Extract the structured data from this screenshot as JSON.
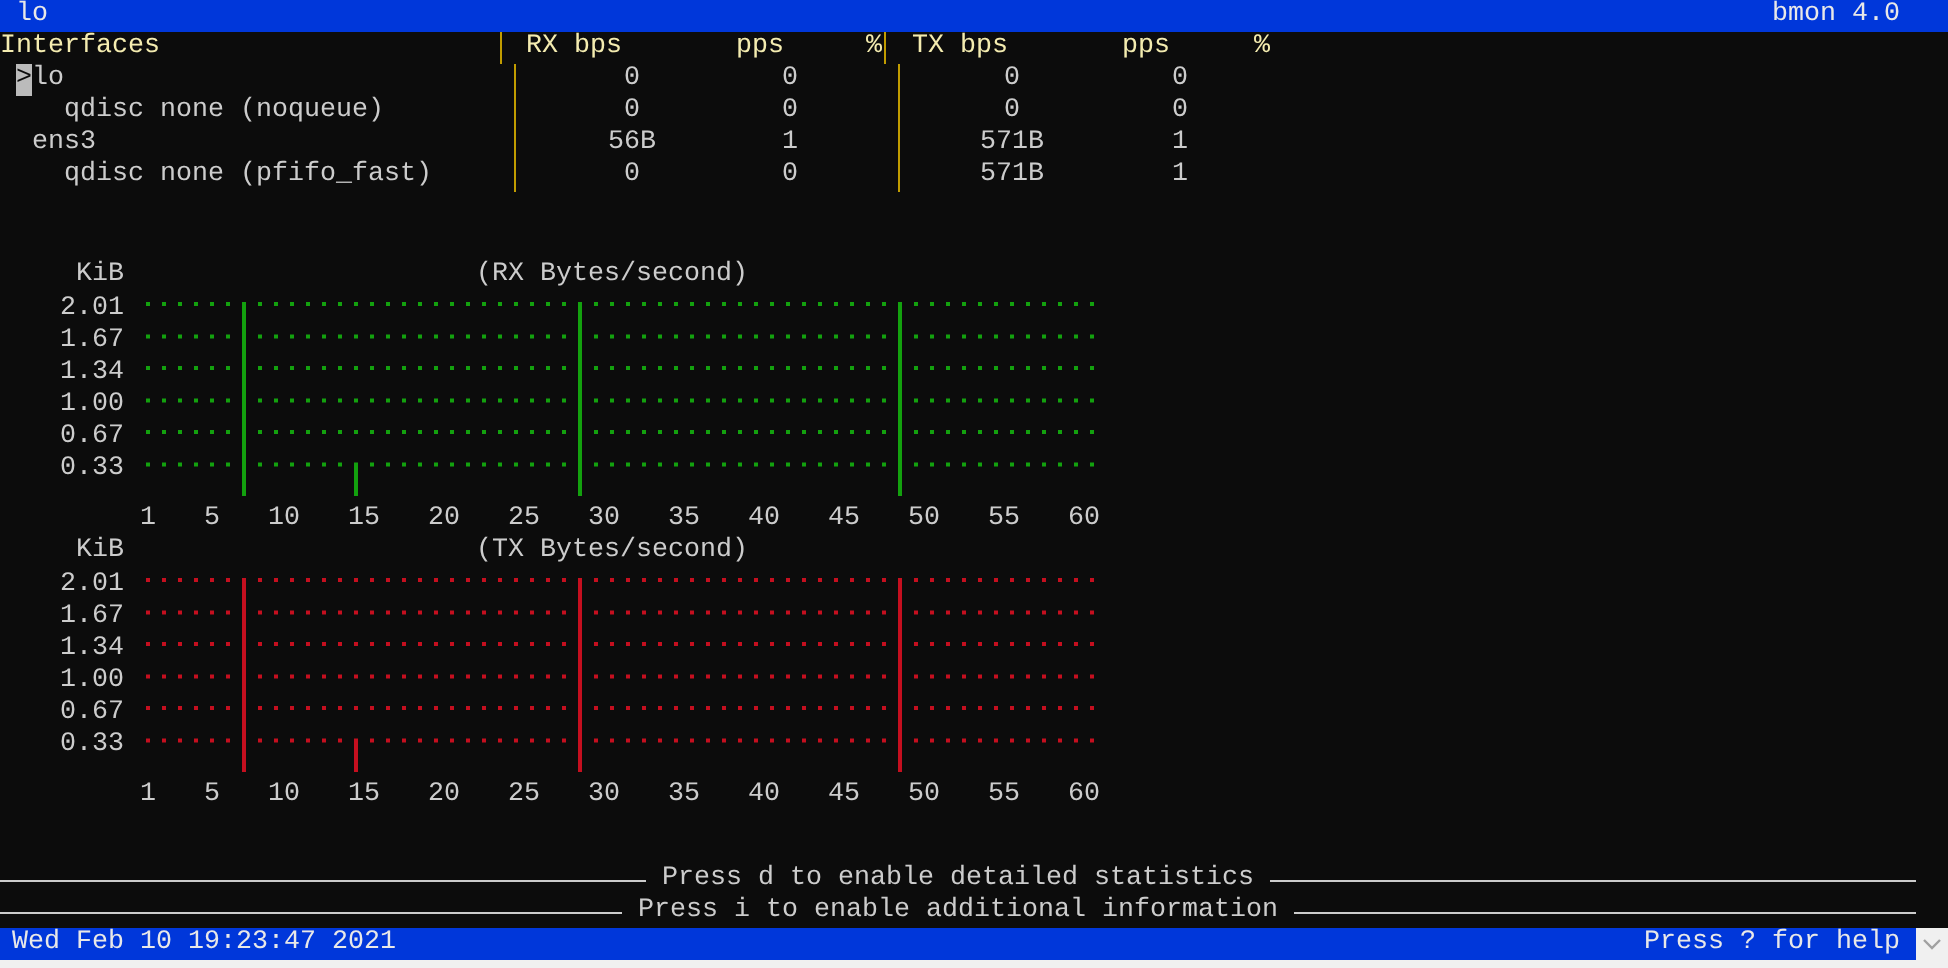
{
  "window": {
    "title": "lo",
    "app": "bmon 4.0"
  },
  "table": {
    "cursor": ">",
    "columns": [
      "Interfaces",
      "RX bps",
      "pps",
      "%",
      "TX bps",
      "pps",
      "%"
    ],
    "rows": [
      {
        "name": "lo",
        "selected": true,
        "rx_bps": "0",
        "rx_pps": "0",
        "tx_bps": "0",
        "tx_pps": "0",
        "children": [
          {
            "name": "qdisc none (noqueue)",
            "selected": false,
            "rx_bps": "0",
            "rx_pps": "0",
            "tx_bps": "0",
            "tx_pps": "0"
          }
        ]
      },
      {
        "name": "ens3",
        "selected": false,
        "rx_bps": "56B",
        "rx_pps": "1",
        "tx_bps": "571B",
        "tx_pps": "1",
        "children": [
          {
            "name": "qdisc none (pfifo_fast)",
            "selected": false,
            "rx_bps": "0",
            "rx_pps": "0",
            "tx_bps": "571B",
            "tx_pps": "1"
          }
        ]
      }
    ]
  },
  "graphs": [
    {
      "chart_data": {
        "type": "bar",
        "title": "(RX Bytes/second)",
        "ylabel": "KiB",
        "x": [
          1,
          2,
          3,
          4,
          5,
          6,
          7,
          8,
          9,
          10,
          11,
          12,
          13,
          14,
          15,
          16,
          17,
          18,
          19,
          20,
          21,
          22,
          23,
          24,
          25,
          26,
          27,
          28,
          29,
          30,
          31,
          32,
          33,
          34,
          35,
          36,
          37,
          38,
          39,
          40,
          41,
          42,
          43,
          44,
          45,
          46,
          47,
          48,
          49,
          50,
          51,
          52,
          53,
          54,
          55,
          56,
          57,
          58,
          59,
          60
        ],
        "series": [
          {
            "color": "#13a10e",
            "values": [
              0,
              0,
              0,
              0,
              0,
              0,
              2.01,
              0,
              0,
              0,
              0,
              0,
              0,
              0.33,
              0,
              0,
              0,
              0,
              0,
              0,
              0,
              0,
              0,
              0,
              0,
              0,
              0,
              2.01,
              0,
              0,
              0,
              0,
              0,
              0,
              0,
              0,
              0,
              0,
              0,
              0,
              0,
              0,
              0,
              0,
              0,
              0,
              0,
              2.01,
              0,
              0,
              0,
              0,
              0,
              0,
              0,
              0,
              0,
              0,
              0,
              0
            ]
          }
        ],
        "ylim": [
          0,
          2.01
        ],
        "xlim": [
          1,
          60
        ],
        "grid": true,
        "xticks": [
          1,
          5,
          10,
          15,
          20,
          25,
          30,
          35,
          40,
          45,
          50,
          55,
          60
        ],
        "yticks": [
          {
            "value": 0.33,
            "label": "0.33"
          },
          {
            "value": 0.67,
            "label": "0.67"
          },
          {
            "value": 1,
            "label": "1.00"
          },
          {
            "value": 1.34,
            "label": "1.34"
          },
          {
            "value": 1.67,
            "label": "1.67"
          },
          {
            "value": 2.01,
            "label": "2.01"
          }
        ]
      }
    },
    {
      "chart_data": {
        "type": "bar",
        "title": "(TX Bytes/second)",
        "ylabel": "KiB",
        "x": [
          1,
          2,
          3,
          4,
          5,
          6,
          7,
          8,
          9,
          10,
          11,
          12,
          13,
          14,
          15,
          16,
          17,
          18,
          19,
          20,
          21,
          22,
          23,
          24,
          25,
          26,
          27,
          28,
          29,
          30,
          31,
          32,
          33,
          34,
          35,
          36,
          37,
          38,
          39,
          40,
          41,
          42,
          43,
          44,
          45,
          46,
          47,
          48,
          49,
          50,
          51,
          52,
          53,
          54,
          55,
          56,
          57,
          58,
          59,
          60
        ],
        "series": [
          {
            "color": "#c50f1f",
            "values": [
              0,
              0,
              0,
              0,
              0,
              0,
              2.01,
              0,
              0,
              0,
              0,
              0,
              0,
              0.33,
              0,
              0,
              0,
              0,
              0,
              0,
              0,
              0,
              0,
              0,
              0,
              0,
              0,
              2.01,
              0,
              0,
              0,
              0,
              0,
              0,
              0,
              0,
              0,
              0,
              0,
              0,
              0,
              0,
              0,
              0,
              0,
              0,
              0,
              2.01,
              0,
              0,
              0,
              0,
              0,
              0,
              0,
              0,
              0,
              0,
              0,
              0
            ]
          }
        ],
        "ylim": [
          0,
          2.01
        ],
        "xlim": [
          1,
          60
        ],
        "grid": true,
        "xticks": [
          1,
          5,
          10,
          15,
          20,
          25,
          30,
          35,
          40,
          45,
          50,
          55,
          60
        ],
        "yticks": [
          {
            "value": 0.33,
            "label": "0.33"
          },
          {
            "value": 0.67,
            "label": "0.67"
          },
          {
            "value": 1,
            "label": "1.00"
          },
          {
            "value": 1.34,
            "label": "1.34"
          },
          {
            "value": 1.67,
            "label": "1.67"
          },
          {
            "value": 2.01,
            "label": "2.01"
          }
        ]
      }
    }
  ],
  "hints": [
    "Press d to enable detailed statistics",
    "Press i to enable additional information"
  ],
  "status_bar": {
    "datetime": "Wed Feb 10 19:23:47 2021",
    "help": "Press ? for help"
  }
}
